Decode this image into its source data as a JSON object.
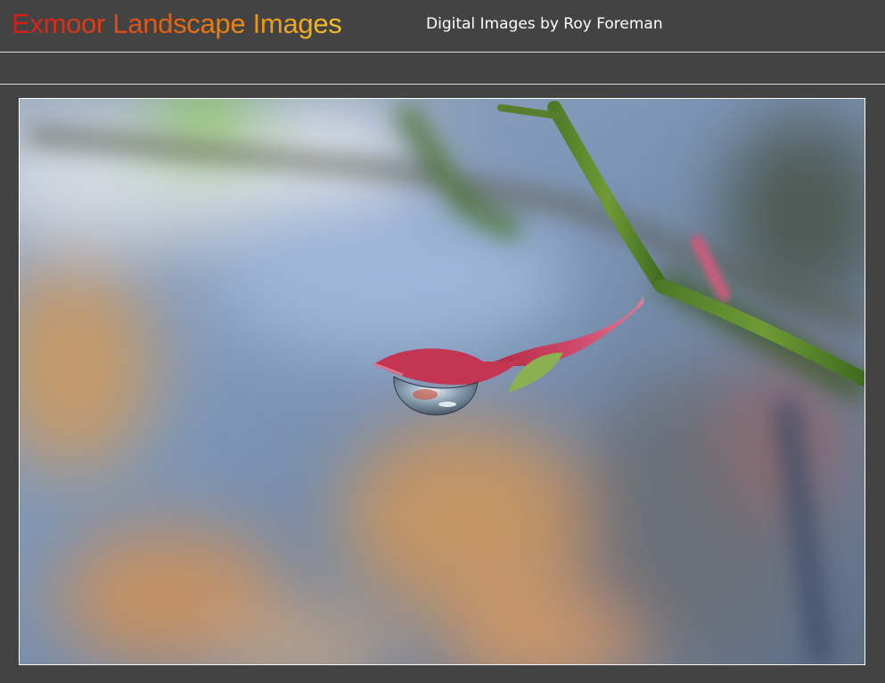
{
  "header": {
    "site_title": "Exmoor Landscape Images",
    "tagline": "Digital Images by Roy Foreman"
  },
  "photo": {
    "subject": "water-droplet-on-rose-bud",
    "colors": {
      "background_gray": "#434343",
      "frame_border": "#ffffff",
      "title_gradient_start": "#d41a1a",
      "title_gradient_end": "#f2c12a"
    }
  }
}
